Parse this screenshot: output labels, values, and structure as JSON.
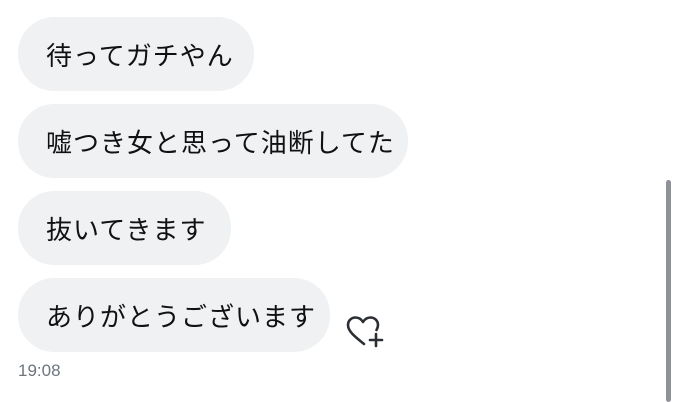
{
  "messages": [
    {
      "text": "待ってガチやん"
    },
    {
      "text": "嘘つき女と思って油断してた"
    },
    {
      "text": "抜いてきます"
    },
    {
      "text": "ありがとうございます"
    }
  ],
  "last_message_time": "19:08",
  "icons": {
    "reaction": "heart-plus-icon"
  },
  "colors": {
    "bubble_background": "#eff1f3",
    "text": "#111111",
    "timestamp": "#6d757d",
    "scrollbar": "#8e9297"
  }
}
